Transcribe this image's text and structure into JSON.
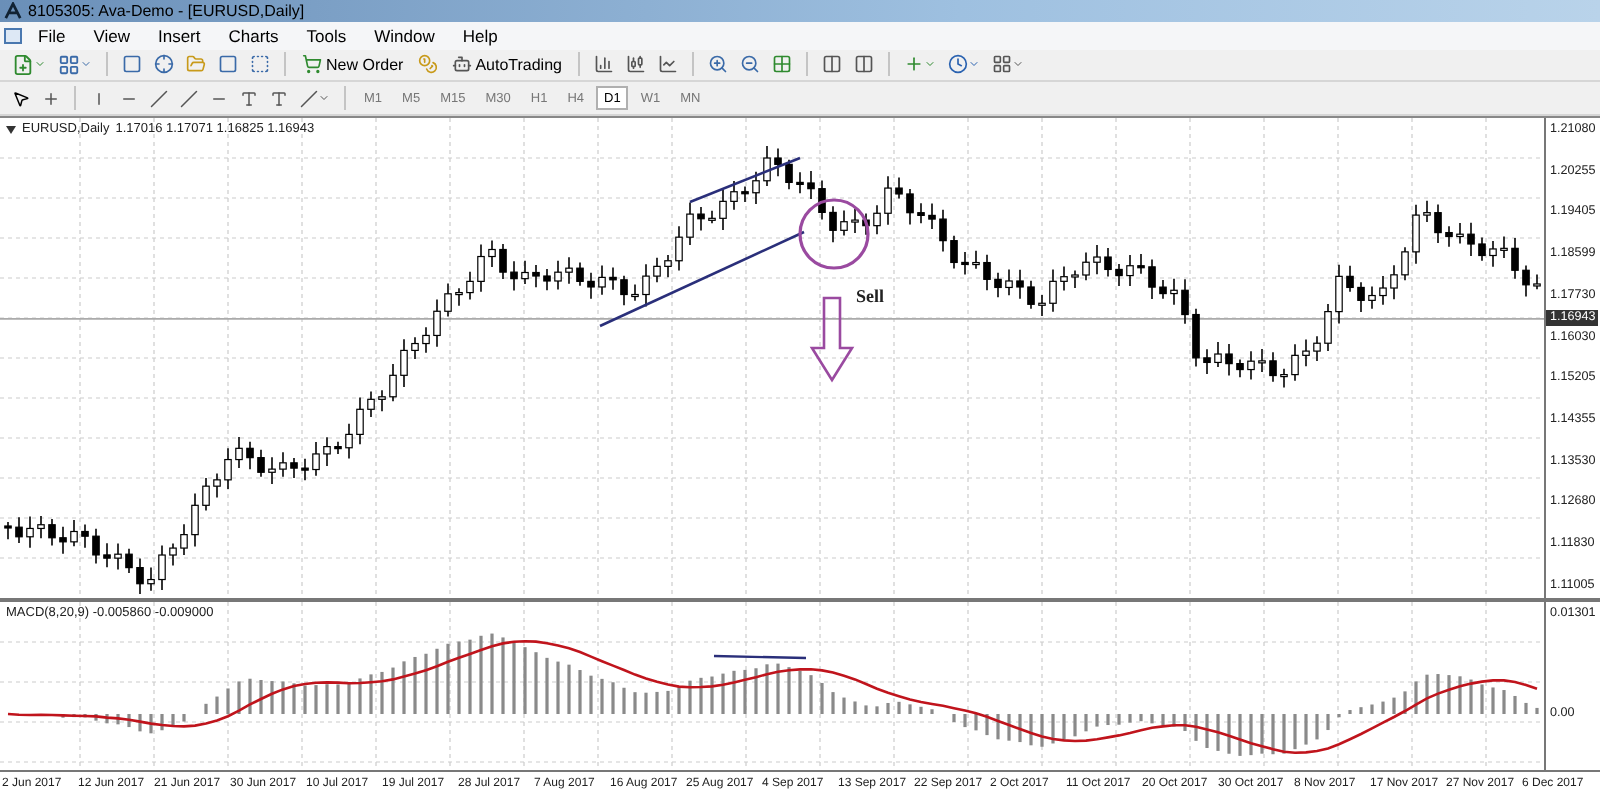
{
  "window": {
    "title": "8105305: Ava-Demo - [EURUSD,Daily]"
  },
  "menu": [
    "File",
    "View",
    "Insert",
    "Charts",
    "Tools",
    "Window",
    "Help"
  ],
  "toolbar": {
    "new_order": "New Order",
    "auto_trading": "AutoTrading"
  },
  "timeframes": [
    {
      "label": "M1",
      "selected": false
    },
    {
      "label": "M5",
      "selected": false
    },
    {
      "label": "M15",
      "selected": false
    },
    {
      "label": "M30",
      "selected": false
    },
    {
      "label": "H1",
      "selected": false
    },
    {
      "label": "H4",
      "selected": false
    },
    {
      "label": "D1",
      "selected": true
    },
    {
      "label": "W1",
      "selected": false
    },
    {
      "label": "MN",
      "selected": false
    }
  ],
  "chart": {
    "symbol": "EURUSD,Daily",
    "ohlc": "1.17016 1.17071 1.16825 1.16943",
    "annotation": "Sell",
    "price_axis": [
      "1.21080",
      "1.20255",
      "1.19405",
      "1.18599",
      "1.17730",
      "1.16030",
      "1.15205",
      "1.14355",
      "1.13530",
      "1.12680",
      "1.11830",
      "1.11005"
    ],
    "current_price": "1.16943"
  },
  "macd": {
    "label": "MACD(8,20,9) -0.005860 -0.009000",
    "axis": [
      "0.01301",
      "0.00"
    ]
  },
  "date_axis": [
    "2 Jun 2017",
    "12 Jun 2017",
    "21 Jun 2017",
    "30 Jun 2017",
    "10 Jul 2017",
    "19 Jul 2017",
    "28 Jul 2017",
    "7 Aug 2017",
    "16 Aug 2017",
    "25 Aug 2017",
    "4 Sep 2017",
    "13 Sep 2017",
    "22 Sep 2017",
    "2 Oct 2017",
    "11 Oct 2017",
    "20 Oct 2017",
    "30 Oct 2017",
    "8 Nov 2017",
    "17 Nov 2017",
    "27 Nov 2017",
    "6 Dec 2017"
  ]
}
